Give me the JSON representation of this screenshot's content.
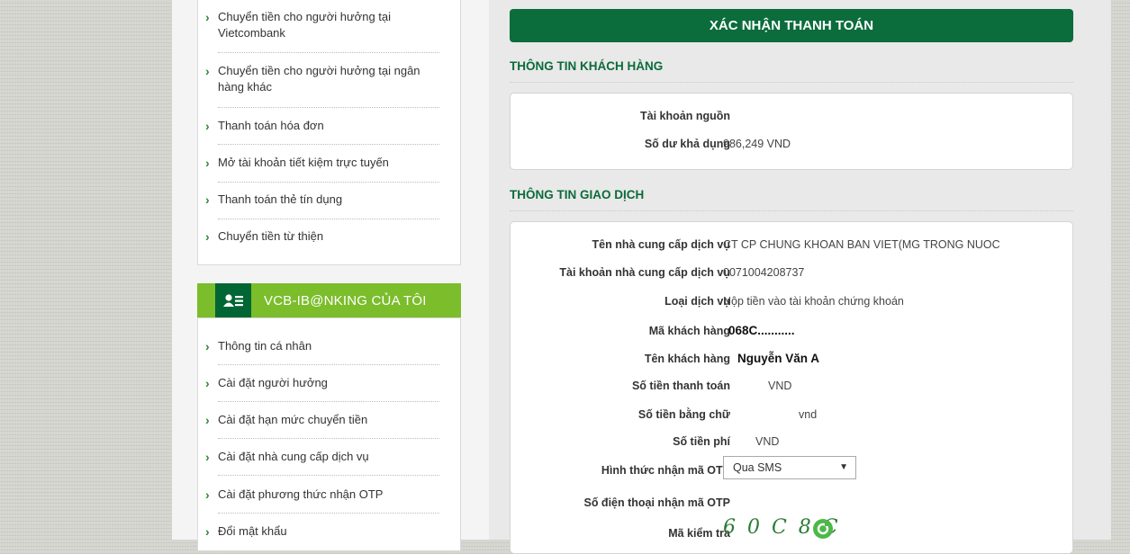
{
  "sidebar_menu": {
    "items": [
      {
        "label": "Chuyển tiền cho người hưởng tại Vietcombank"
      },
      {
        "label": "Chuyển tiền cho người hưởng tại ngân hàng khác"
      },
      {
        "label": "Thanh toán hóa đơn"
      },
      {
        "label": "Mở tài khoản tiết kiệm trực tuyến"
      },
      {
        "label": "Thanh toán thẻ tín dụng"
      },
      {
        "label": "Chuyển tiền từ thiện"
      }
    ]
  },
  "vcb_menu": {
    "title": "VCB-IB@NKING CỦA TÔI",
    "items": [
      {
        "label": "Thông tin cá nhân"
      },
      {
        "label": "Cài đặt người hưởng"
      },
      {
        "label": "Cài đặt hạn mức chuyển tiền"
      },
      {
        "label": "Cài đặt nhà cung cấp dịch vụ"
      },
      {
        "label": "Cài đặt phương thức nhận OTP"
      },
      {
        "label": "Đổi mật khẩu"
      }
    ]
  },
  "confirm": {
    "title": "XÁC NHẬN THANH TOÁN",
    "customer_section": {
      "title": "THÔNG TIN KHÁCH HÀNG",
      "source_account_label": "Tài khoản nguồn",
      "source_account_value": "",
      "balance_label": "Số dư khả dụng",
      "balance_value": "986,249 VND"
    },
    "transaction_section": {
      "title": "THÔNG TIN GIAO DỊCH",
      "provider_name_label": "Tên nhà cung cấp dịch vụ",
      "provider_name_value": "CT CP CHUNG KHOAN BAN VIET(MG TRONG NUOC",
      "provider_account_label": "Tài khoản nhà cung cấp dịch vụ",
      "provider_account_value": "0071004208737",
      "service_type_label": "Loại dịch vụ",
      "service_type_value": "Nộp tiền vào tài khoản chứng khoán",
      "customer_code_label": "Mã khách hàng",
      "customer_code_value": "068C...........",
      "customer_name_label": "Tên khách hàng",
      "customer_name_value": "Nguyễn Văn A",
      "amount_label": "Số tiền thanh toán",
      "amount_unit": "VND",
      "amount_words_label": "Số tiền bằng chữ",
      "amount_words_unit": "vnd",
      "fee_label": "Số tiền phí",
      "fee_unit": "VND",
      "otp_method_label": "Hình thức nhận mã OTP",
      "otp_method_value": "Qua SMS",
      "otp_phone_label": "Số điện thoại nhận mã OTP",
      "captcha_label": "Mã kiểm tra",
      "captcha_value": "6 0 C 8 C"
    }
  }
}
